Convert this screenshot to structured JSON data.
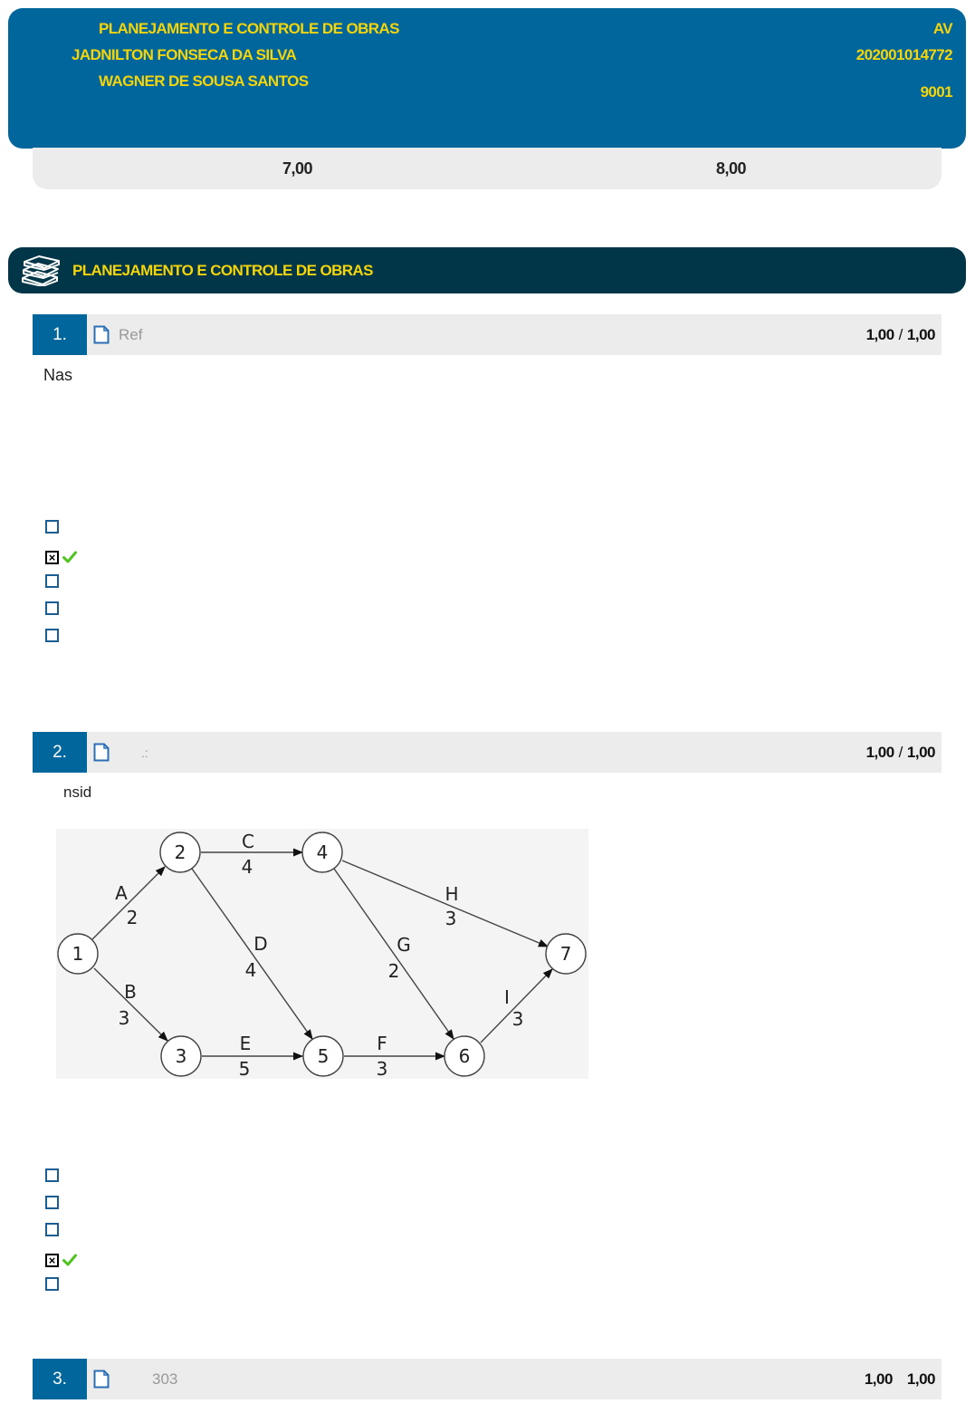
{
  "header": {
    "course": "PLANEJAMENTO E CONTROLE DE OBRAS",
    "student": "JADNILTON FONSECA DA SILVA",
    "teacher": "WAGNER DE SOUSA SANTOS",
    "exam_type": "AV",
    "registration": "202001014772",
    "class_code": "9001"
  },
  "scores": {
    "left": "7,00",
    "right": "8,00"
  },
  "section": {
    "title": "PLANEJAMENTO E CONTROLE DE OBRAS",
    "icon": "books-icon"
  },
  "questions": [
    {
      "number": "1.",
      "ref": "Ref",
      "score": "1,00",
      "sep": "/",
      "max": "1,00",
      "text": "Nas",
      "options_selected": [
        false,
        true,
        false,
        false,
        false
      ]
    },
    {
      "number": "2.",
      "ref": ".:",
      "score": "1,00",
      "sep": "/",
      "max": "1,00",
      "text": "nsid",
      "options_selected": [
        false,
        false,
        false,
        true,
        false
      ]
    },
    {
      "number": "3.",
      "ref": "303",
      "score": "1,00",
      "sep": "",
      "max": "1,00"
    }
  ],
  "network": {
    "nodes": [
      "1",
      "2",
      "3",
      "4",
      "5",
      "6",
      "7"
    ],
    "activities": [
      {
        "label": "A",
        "duration": "2"
      },
      {
        "label": "B",
        "duration": "3"
      },
      {
        "label": "C",
        "duration": "4"
      },
      {
        "label": "D",
        "duration": "4"
      },
      {
        "label": "E",
        "duration": "5"
      },
      {
        "label": "F",
        "duration": "3"
      },
      {
        "label": "G",
        "duration": "2"
      },
      {
        "label": "H",
        "duration": "3"
      },
      {
        "label": "I",
        "duration": "3"
      }
    ]
  }
}
